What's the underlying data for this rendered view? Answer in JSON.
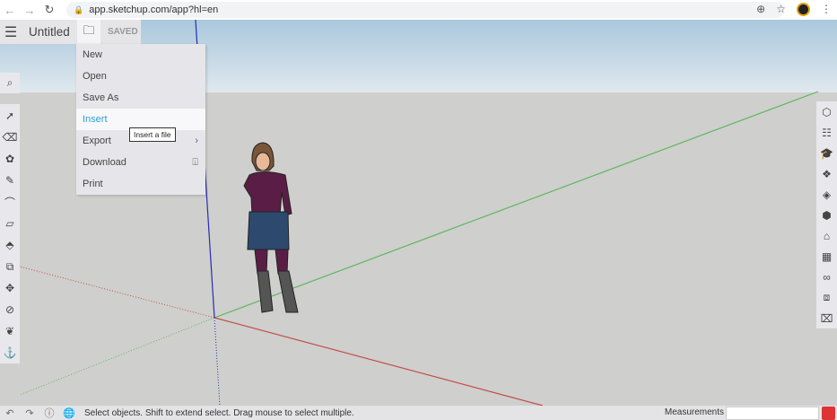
{
  "browser": {
    "url": "app.sketchup.com/app?hl=en"
  },
  "app": {
    "title": "Untitled",
    "saved_label": "SAVED"
  },
  "file_menu": {
    "items": [
      {
        "label": "New"
      },
      {
        "label": "Open"
      },
      {
        "label": "Save As"
      },
      {
        "label": "Insert"
      },
      {
        "label": "Export"
      },
      {
        "label": "Download"
      },
      {
        "label": "Print"
      }
    ],
    "tooltip": "Insert a file"
  },
  "status": {
    "message": "Select objects. Shift to extend select. Drag mouse to select multiple.",
    "measurements_label": "Measurements",
    "measurements_value": ""
  },
  "colors": {
    "accent": "#2a9fd6",
    "axis_red": "#c0504d",
    "axis_green": "#5cb85c",
    "axis_blue": "#2b2bb0"
  }
}
